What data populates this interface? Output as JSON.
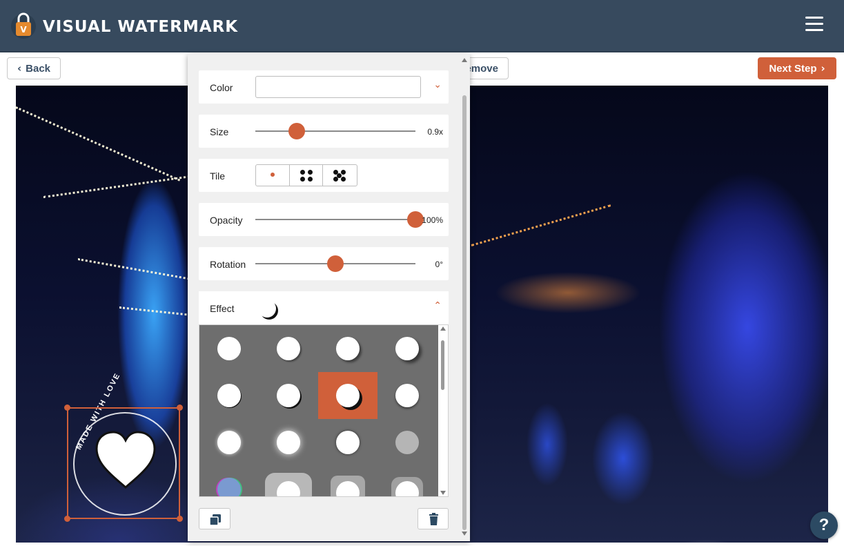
{
  "header": {
    "brand": "VISUAL WATERMARK",
    "logo_letter": "V",
    "menu_icon": "hamburger-icon"
  },
  "toolbar": {
    "back_label": "Back",
    "remove_label": "emove",
    "next_label": "Next Step"
  },
  "watermark": {
    "text": "MADE WITH LOVE"
  },
  "panel": {
    "color_label": "Color",
    "color_value": "",
    "size_label": "Size",
    "size_value": "0.9x",
    "size_level": 0.26,
    "tile_label": "Tile",
    "tile_options": [
      "single",
      "grid-4",
      "grid-5"
    ],
    "opacity_label": "Opacity",
    "opacity_value": "100%",
    "opacity_level": 1.0,
    "rotation_label": "Rotation",
    "rotation_value": "0°",
    "rotation_level": 0.5,
    "effect_label": "Effect",
    "effects_selected_index": 6
  },
  "help_label": "?",
  "colors": {
    "accent": "#d0603a",
    "header_bg": "#374a5e",
    "help_bg": "#2c4a63"
  }
}
